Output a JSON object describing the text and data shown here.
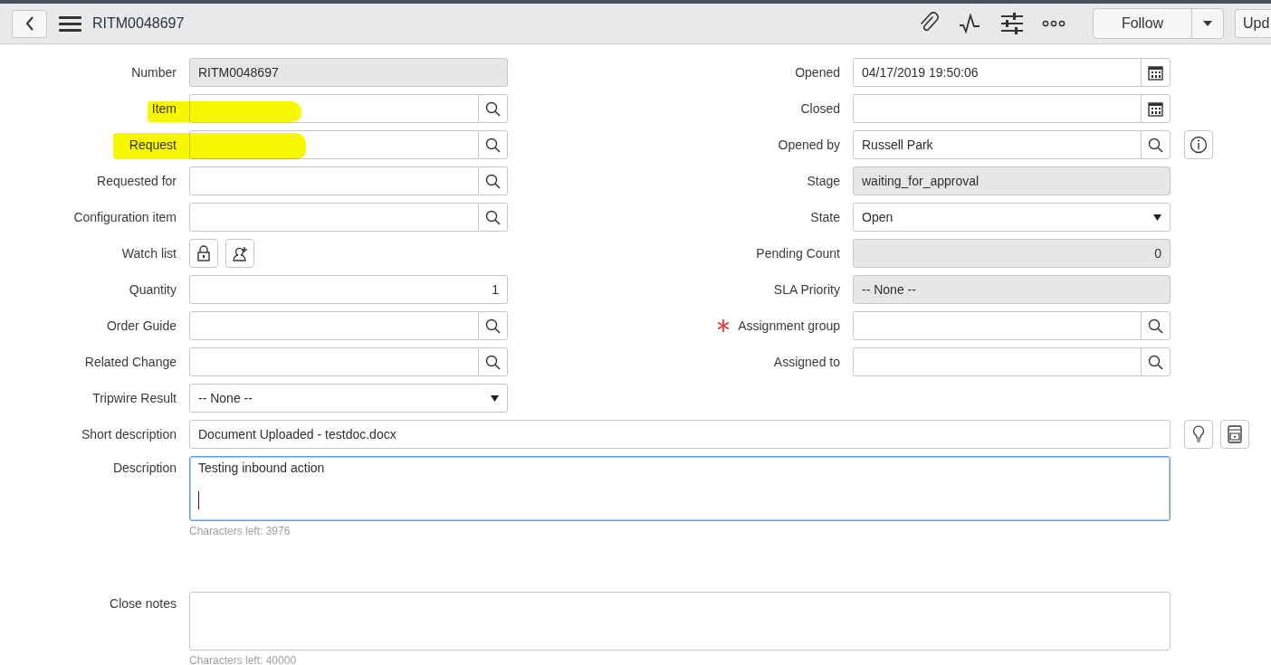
{
  "header": {
    "title": "RITM0048697",
    "follow_button": "Follow",
    "update_button": "Upd"
  },
  "left_fields": [
    {
      "label": "Number",
      "kind": "readonly",
      "value": "RITM0048697",
      "highlighted": false
    },
    {
      "label": "Item",
      "kind": "reference",
      "highlighted": true
    },
    {
      "label": "Request",
      "kind": "reference",
      "highlighted": true
    },
    {
      "label": "Requested for",
      "kind": "reference",
      "highlighted": false
    },
    {
      "label": "Configuration item",
      "kind": "reference",
      "highlighted": false
    },
    {
      "label": "Watch list",
      "kind": "watchlist",
      "highlighted": false
    },
    {
      "label": "Quantity",
      "kind": "number",
      "value": "1",
      "highlighted": false
    },
    {
      "label": "Order Guide",
      "kind": "reference",
      "highlighted": false
    },
    {
      "label": "Related Change",
      "kind": "reference",
      "highlighted": false
    },
    {
      "label": "Tripwire Result",
      "kind": "select",
      "value": "-- None --",
      "highlighted": false
    }
  ],
  "right_fields": [
    {
      "label": "Opened",
      "kind": "date",
      "value": "04/17/2019 19:50:06",
      "mandatory": false
    },
    {
      "label": "Closed",
      "kind": "date",
      "mandatory": false
    },
    {
      "label": "Opened by",
      "kind": "reference",
      "value": "Russell Park",
      "mandatory": false,
      "info_button": true
    },
    {
      "label": "Stage",
      "kind": "readonly",
      "value": "waiting_for_approval",
      "mandatory": false
    },
    {
      "label": "State",
      "kind": "select",
      "value": "Open",
      "mandatory": false
    },
    {
      "label": "Pending Count",
      "kind": "readonly_number",
      "value": "0",
      "mandatory": false
    },
    {
      "label": "SLA Priority",
      "kind": "readonly",
      "value": "-- None --",
      "mandatory": false
    },
    {
      "label": "Assignment group",
      "kind": "reference",
      "mandatory": true
    },
    {
      "label": "Assigned to",
      "kind": "reference",
      "mandatory": false
    }
  ],
  "short_description": {
    "label": "Short description",
    "value": "Document Uploaded - testdoc.docx"
  },
  "text_areas": [
    {
      "label": "Description",
      "value": "Testing inbound action",
      "focused": true,
      "characters_left": "Characters left: 3976"
    },
    {
      "label": "Close notes",
      "focused": false,
      "characters_left": "Characters left: 40000"
    }
  ]
}
